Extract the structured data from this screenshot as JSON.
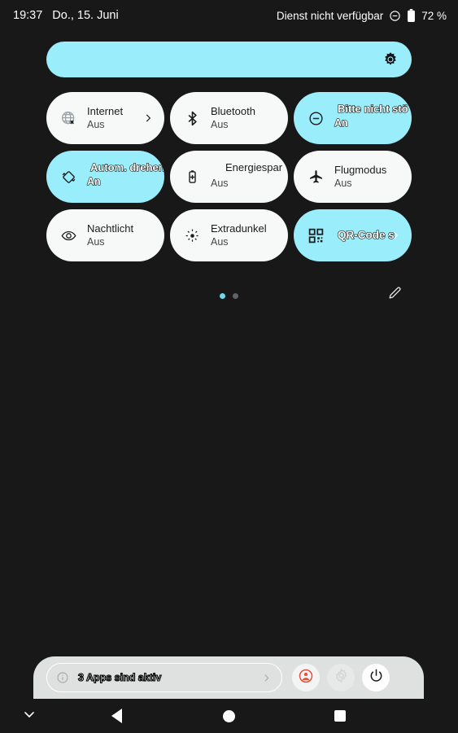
{
  "statusbar": {
    "time": "19:37",
    "date": "Do., 15. Juni",
    "carrier": "Dienst nicht verfügbar",
    "dnd_icon": "do-not-disturb-icon",
    "battery_icon": "battery-icon",
    "battery": "72 %"
  },
  "brightness": {
    "icon": "brightness-icon",
    "level_percent": 100,
    "accent": "#9aedfb"
  },
  "tiles": [
    {
      "name": "Internet",
      "state": "Aus",
      "icon": "globe-off-icon",
      "active": false,
      "chevron": true,
      "outlined": false,
      "truncated": false
    },
    {
      "name": "Bluetooth",
      "state": "Aus",
      "icon": "bluetooth-icon",
      "active": false,
      "chevron": false,
      "outlined": false,
      "truncated": false
    },
    {
      "name": "Bitte nicht stö",
      "state": "An",
      "icon": "do-not-disturb-icon",
      "active": true,
      "chevron": false,
      "outlined": true,
      "truncated": true
    },
    {
      "name": "Autom. drehen",
      "state": "An",
      "icon": "auto-rotate-icon",
      "active": true,
      "chevron": false,
      "outlined": true,
      "truncated": true
    },
    {
      "name": "Energiespar",
      "state": "Aus",
      "icon": "battery-saver-icon",
      "active": false,
      "chevron": false,
      "outlined": false,
      "truncated": true
    },
    {
      "name": "Flugmodus",
      "state": "Aus",
      "icon": "airplane-icon",
      "active": false,
      "chevron": false,
      "outlined": false,
      "truncated": false
    },
    {
      "name": "Nachtlicht",
      "state": "Aus",
      "icon": "eye-icon",
      "active": false,
      "chevron": false,
      "outlined": false,
      "truncated": false
    },
    {
      "name": "Extradunkel",
      "state": "Aus",
      "icon": "dim-sun-icon",
      "active": false,
      "chevron": false,
      "outlined": false,
      "truncated": false
    },
    {
      "name": "QR-Code s",
      "state": "",
      "icon": "qr-code-icon",
      "active": true,
      "chevron": true,
      "outlined": true,
      "truncated": true
    }
  ],
  "pager": {
    "pages": 2,
    "current": 1,
    "edit_icon": "pencil-icon"
  },
  "bottom": {
    "info_icon": "info-icon",
    "active_apps": "3 Apps sind aktiv",
    "chevron_icon": "chevron-right-icon",
    "user_icon": "user-account-icon",
    "user_icon_color": "#e8503a",
    "settings_icon": "gear-icon",
    "power_icon": "power-icon"
  },
  "navbar": {
    "dismiss_icon": "chevron-down-icon",
    "back_icon": "back-triangle-icon",
    "home_icon": "home-circle-icon",
    "recents_icon": "recents-square-icon"
  }
}
